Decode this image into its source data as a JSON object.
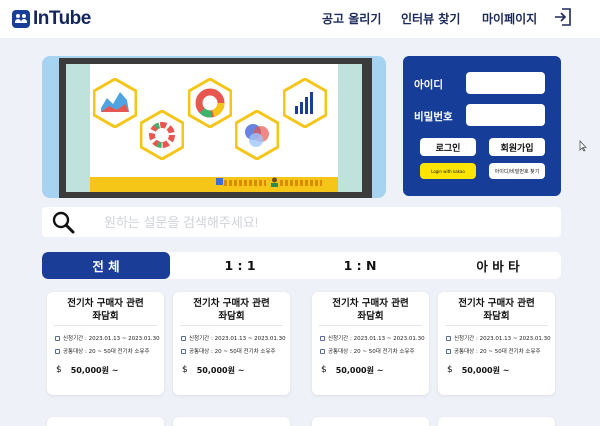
{
  "app": {
    "logo_text": "InTube"
  },
  "header": {
    "nav": [
      "공고 올리기",
      "인터뷰 찾기",
      "마이페이지"
    ],
    "logout_icon": "logout-icon"
  },
  "login": {
    "id_label": "아이디",
    "pw_label": "비밀번호",
    "login_button": "로그인",
    "signup_button": "회원가입",
    "kakao_button": "Login with kakao",
    "find_button": "아이디/비밀번호 찾기"
  },
  "search": {
    "placeholder": "원하는 설문을 검색해주세요!",
    "icon": "search-icon"
  },
  "tabs": [
    "전 체",
    "1 : 1",
    "1 : N",
    "아 바 타"
  ],
  "cards": [
    {
      "title_line1": "전기차 구매자 관련",
      "title_line2": "좌담회",
      "period": "신청기간 : 2023.01.13 ~ 2023.01.30",
      "target": "공통대상 : 20 ~ 50대 전기차 소유주",
      "currency": "$",
      "price": "50,000원 ~"
    },
    {
      "title_line1": "전기차 구매자 관련",
      "title_line2": "좌담회",
      "period": "신청기간 : 2023.01.13 ~ 2023.01.30",
      "target": "공통대상 : 20 ~ 50대 전기차 소유주",
      "currency": "$",
      "price": "50,000원 ~"
    },
    {
      "title_line1": "전기차 구매자 관련",
      "title_line2": "좌담회",
      "period": "신청기간 : 2023.01.13 ~ 2023.01.30",
      "target": "공통대상 : 20 ~ 50대 전기차 소유주",
      "currency": "$",
      "price": "50,000원 ~"
    },
    {
      "title_line1": "전기차 구매자 관련",
      "title_line2": "좌담회",
      "period": "신청기간 : 2023.01.13 ~ 2023.01.30",
      "target": "공통대상 : 20 ~ 50대 전기차 소유주",
      "currency": "$",
      "price": "50,000원 ~"
    }
  ],
  "colors": {
    "brand": "#1a3e98",
    "background": "#eef1f7",
    "banner": "#a6d3f0",
    "accent_yellow": "#f5c518"
  }
}
